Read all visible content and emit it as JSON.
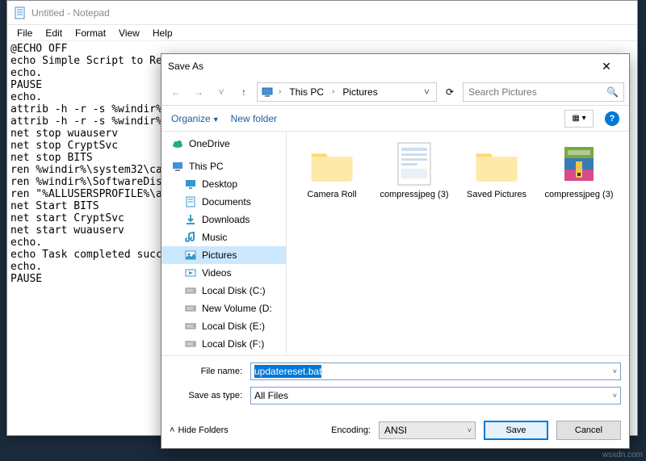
{
  "notepad": {
    "title": "Untitled - Notepad",
    "menu": [
      "File",
      "Edit",
      "Format",
      "View",
      "Help"
    ],
    "content": "@ECHO OFF\necho Simple Script to Re\necho.\nPAUSE\necho.\nattrib -h -r -s %windir%\nattrib -h -r -s %windir%\nnet stop wuauserv\nnet stop CryptSvc\nnet stop BITS\nren %windir%\\system32\\ca\nren %windir%\\SoftwareDis\nren \"%ALLUSERSPROFILE%\\a\nnet Start BITS\nnet start CryptSvc\nnet start wuauserv\necho.\necho Task completed succ\necho.\nPAUSE"
  },
  "dialog": {
    "title": "Save As",
    "breadcrumb": {
      "root": "This PC",
      "folder": "Pictures"
    },
    "search": {
      "placeholder": "Search Pictures"
    },
    "toolbar": {
      "organize": "Organize",
      "newfolder": "New folder"
    },
    "tree": [
      {
        "label": "OneDrive",
        "icon": "cloud",
        "indent": false
      },
      {
        "sep": true
      },
      {
        "label": "This PC",
        "icon": "pc",
        "indent": false
      },
      {
        "label": "Desktop",
        "icon": "desktop",
        "indent": true
      },
      {
        "label": "Documents",
        "icon": "doc",
        "indent": true
      },
      {
        "label": "Downloads",
        "icon": "down",
        "indent": true
      },
      {
        "label": "Music",
        "icon": "music",
        "indent": true
      },
      {
        "label": "Pictures",
        "icon": "pic",
        "indent": true,
        "sel": true
      },
      {
        "label": "Videos",
        "icon": "video",
        "indent": true
      },
      {
        "label": "Local Disk (C:)",
        "icon": "disk",
        "indent": true
      },
      {
        "label": "New Volume (D:",
        "icon": "disk",
        "indent": true
      },
      {
        "label": "Local Disk (E:)",
        "icon": "disk",
        "indent": true
      },
      {
        "label": "Local Disk (F:)",
        "icon": "disk",
        "indent": true
      }
    ],
    "files": [
      {
        "label": "Camera Roll",
        "type": "folder"
      },
      {
        "label": "compressjpeg (3)",
        "type": "doc"
      },
      {
        "label": "Saved Pictures",
        "type": "folder"
      },
      {
        "label": "compressjpeg (3)",
        "type": "rar"
      }
    ],
    "filename_label": "File name:",
    "filename_value": "updatereset.bat",
    "saveas_label": "Save as type:",
    "saveas_value": "All Files",
    "hide_folders": "Hide Folders",
    "encoding_label": "Encoding:",
    "encoding_value": "ANSI",
    "save_btn": "Save",
    "cancel_btn": "Cancel"
  },
  "watermark": "wsxdn.com"
}
